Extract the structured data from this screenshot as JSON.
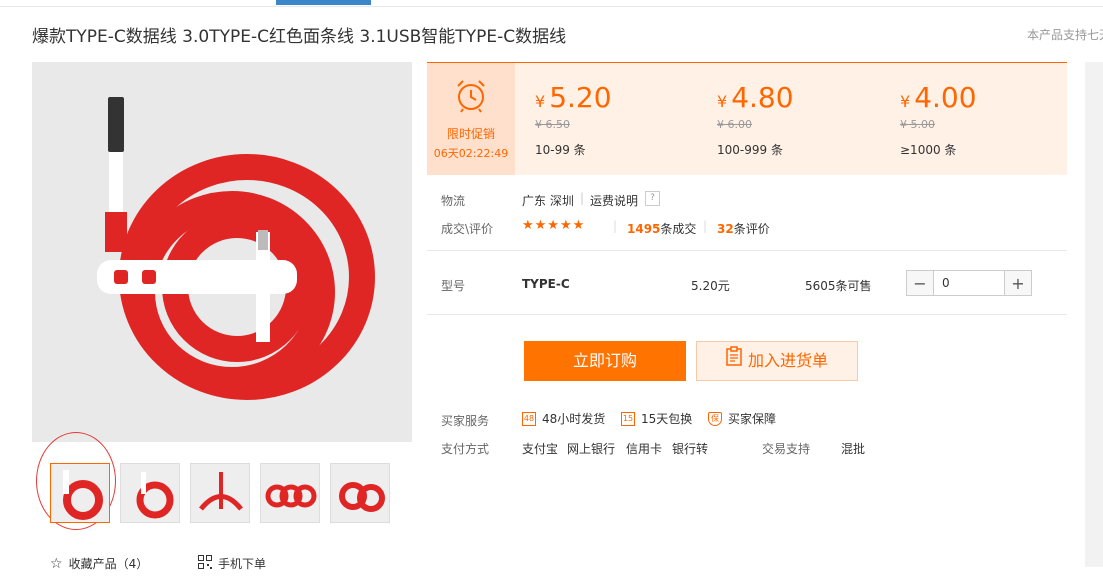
{
  "product": {
    "title": "爆款TYPE-C数据线 3.0TYPE-C红色面条线 3.1USB智能TYPE-C数据线",
    "support_text": "本产品支持七天",
    "main_image_icon": "red-usb-c-cable-image"
  },
  "promo": {
    "label": "限时促销",
    "countdown": "06天02:22:49",
    "icon": "alarm-clock-icon"
  },
  "price_tiers": [
    {
      "currency": "¥",
      "price": "5.20",
      "old_price": "¥ 6.50",
      "qty": "10-99 条"
    },
    {
      "currency": "¥",
      "price": "4.80",
      "old_price": "¥ 6.00",
      "qty": "100-999 条"
    },
    {
      "currency": "¥",
      "price": "4.00",
      "old_price": "¥ 5.00",
      "qty": "≥1000 条"
    }
  ],
  "logistics": {
    "label": "物流",
    "location": "广东 深圳",
    "separator": "|",
    "freight_link": "运费说明",
    "help_icon": "?"
  },
  "deal": {
    "label": "成交\\评价",
    "stars": "★★★★★",
    "count": "1495",
    "count_suffix": "条成交",
    "reviews": "32",
    "reviews_suffix": "条评价"
  },
  "sku": {
    "label": "型号",
    "name": "TYPE-C",
    "price": "5.20元",
    "stock": "5605条可售",
    "minus": "−",
    "quantity": "0",
    "plus": "+"
  },
  "actions": {
    "buy_now": "立即订购",
    "add_to_cart": "加入进货单"
  },
  "services": {
    "label": "买家服务",
    "items": [
      {
        "icon_text": "48",
        "label": "48小时发货"
      },
      {
        "icon_text": "15",
        "label": "15天包换"
      },
      {
        "icon_text": "保",
        "label": "买家保障"
      }
    ]
  },
  "payment": {
    "label": "支付方式",
    "methods": [
      "支付宝",
      "网上银行",
      "信用卡",
      "银行转"
    ],
    "trade_label": "交易支持",
    "trade_value": "混批"
  },
  "bottom": {
    "favorite_label": "收藏产品（4）",
    "mobile_label": "手机下单"
  },
  "colors": {
    "accent": "#ff6600",
    "promo_bg": "#ffe0cc",
    "price_bg": "#fff1e6",
    "cable_red": "#e02525"
  }
}
